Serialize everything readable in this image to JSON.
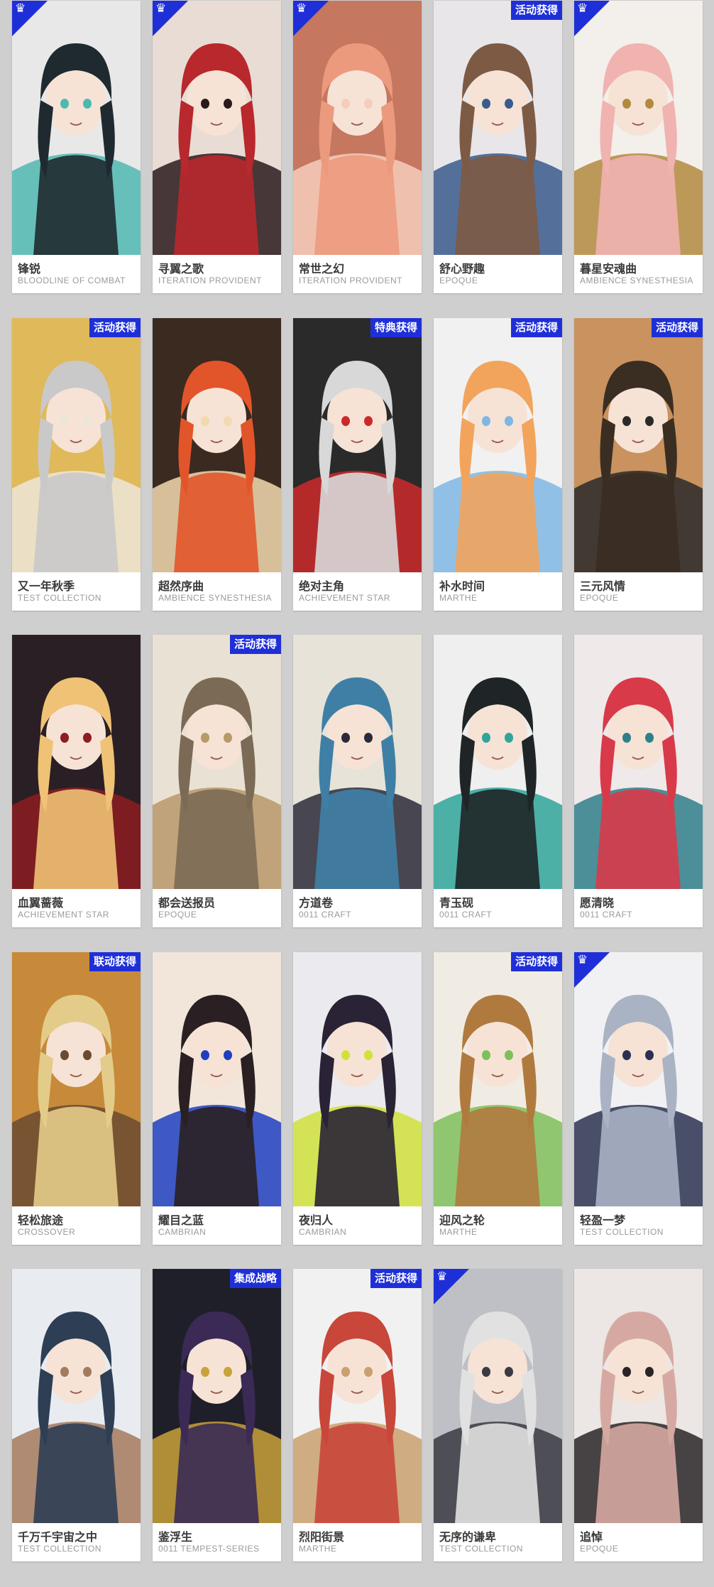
{
  "badge_icon": "trophy-icon",
  "accent": "#1f2fd8",
  "cards": [
    {
      "name": "锋锐",
      "series": "BLOODLINE OF COMBAT",
      "tag": "",
      "corner": true,
      "palette": [
        "#1f2a30",
        "#4fb8b0",
        "#e8e8e8"
      ]
    },
    {
      "name": "寻翼之歌",
      "series": "ITERATION PROVIDENT",
      "tag": "",
      "corner": true,
      "palette": [
        "#b8282c",
        "#2a1a1c",
        "#e9dcd4"
      ]
    },
    {
      "name": "常世之幻",
      "series": "ITERATION PROVIDENT",
      "tag": "",
      "corner": true,
      "palette": [
        "#ec9a7e",
        "#f6cdbb",
        "#c67760"
      ]
    },
    {
      "name": "舒心野趣",
      "series": "EPOQUE",
      "tag": "活动获得",
      "corner": false,
      "palette": [
        "#7d5a44",
        "#3a5b8c",
        "#e9e6ea"
      ]
    },
    {
      "name": "暮星安魂曲",
      "series": "AMBIENCE SYNESTHESIA",
      "tag": "",
      "corner": true,
      "palette": [
        "#f0b3b0",
        "#b28a3e",
        "#f3efeb"
      ]
    },
    {
      "name": "又一年秋季",
      "series": "TEST COLLECTION",
      "tag": "活动获得",
      "corner": false,
      "palette": [
        "#c9c9c9",
        "#ece6d8",
        "#e0b95a"
      ]
    },
    {
      "name": "超然序曲",
      "series": "AMBIENCE SYNESTHESIA",
      "tag": "",
      "corner": false,
      "palette": [
        "#e2552b",
        "#f3d9b0",
        "#3a2a20"
      ]
    },
    {
      "name": "绝对主角",
      "series": "ACHIEVEMENT STAR",
      "tag": "特典获得",
      "corner": false,
      "palette": [
        "#d8d8d8",
        "#cc2a2a",
        "#2a2a2a"
      ]
    },
    {
      "name": "补水时间",
      "series": "MARTHE",
      "tag": "活动获得",
      "corner": false,
      "palette": [
        "#f2a45c",
        "#7fb7e3",
        "#f1f1f1"
      ]
    },
    {
      "name": "三元风情",
      "series": "EPOQUE",
      "tag": "活动获得",
      "corner": false,
      "palette": [
        "#3a2e22",
        "#2a2a2a",
        "#c9925e"
      ]
    },
    {
      "name": "血翼蔷薇",
      "series": "ACHIEVEMENT STAR",
      "tag": "",
      "corner": false,
      "palette": [
        "#f0c276",
        "#8c1d22",
        "#2a1f24"
      ]
    },
    {
      "name": "都会送报员",
      "series": "EPOQUE",
      "tag": "活动获得",
      "corner": false,
      "palette": [
        "#7b6a55",
        "#b9986a",
        "#e9e1d3"
      ]
    },
    {
      "name": "方道卷",
      "series": "0011 CRAFT",
      "tag": "",
      "corner": false,
      "palette": [
        "#3f7fa6",
        "#2a2a3a",
        "#e7e3d8"
      ]
    },
    {
      "name": "青玉砚",
      "series": "0011 CRAFT",
      "tag": "",
      "corner": false,
      "palette": [
        "#1f2526",
        "#2fa59a",
        "#efefef"
      ]
    },
    {
      "name": "愿清晓",
      "series": "0011 CRAFT",
      "tag": "",
      "corner": false,
      "palette": [
        "#d83a4a",
        "#2f7f8a",
        "#efe9e9"
      ]
    },
    {
      "name": "轻松旅途",
      "series": "CROSSOVER",
      "tag": "联动获得",
      "corner": false,
      "palette": [
        "#e3cc8a",
        "#6a4a32",
        "#c78a3a"
      ]
    },
    {
      "name": "耀目之蓝",
      "series": "CAMBRIAN",
      "tag": "",
      "corner": false,
      "palette": [
        "#2a1f22",
        "#1f3fbf",
        "#f1e6d9"
      ]
    },
    {
      "name": "夜归人",
      "series": "CAMBRIAN",
      "tag": "",
      "corner": false,
      "palette": [
        "#2a2235",
        "#cfe23a",
        "#ebebef"
      ]
    },
    {
      "name": "迎风之轮",
      "series": "MARTHE",
      "tag": "活动获得",
      "corner": false,
      "palette": [
        "#b07a3f",
        "#7fbf5a",
        "#f1ece3"
      ]
    },
    {
      "name": "轻盈一梦",
      "series": "TEST COLLECTION",
      "tag": "",
      "corner": true,
      "palette": [
        "#a9b3c4",
        "#2b3150",
        "#f1f1f4"
      ]
    },
    {
      "name": "千万千宇宙之中",
      "series": "TEST COLLECTION",
      "tag": "",
      "corner": false,
      "palette": [
        "#2d3e55",
        "#a37a5c",
        "#e8ecf1"
      ]
    },
    {
      "name": "鉴浮生",
      "series": "0011 TEMPEST-SERIES",
      "tag": "集成战略",
      "corner": false,
      "palette": [
        "#3a2a55",
        "#c9a23a",
        "#1f1f2a"
      ]
    },
    {
      "name": "烈阳街景",
      "series": "MARTHE",
      "tag": "活动获得",
      "corner": false,
      "palette": [
        "#c8463a",
        "#caa070",
        "#f1f1f1"
      ]
    },
    {
      "name": "无序的谦卑",
      "series": "TEST COLLECTION",
      "tag": "",
      "corner": true,
      "palette": [
        "#e1e1e1",
        "#3a3a42",
        "#bfbfc6"
      ]
    },
    {
      "name": "追悼",
      "series": "EPOQUE",
      "tag": "",
      "corner": false,
      "palette": [
        "#d5a9a1",
        "#2a2428",
        "#ece6e4"
      ]
    }
  ]
}
